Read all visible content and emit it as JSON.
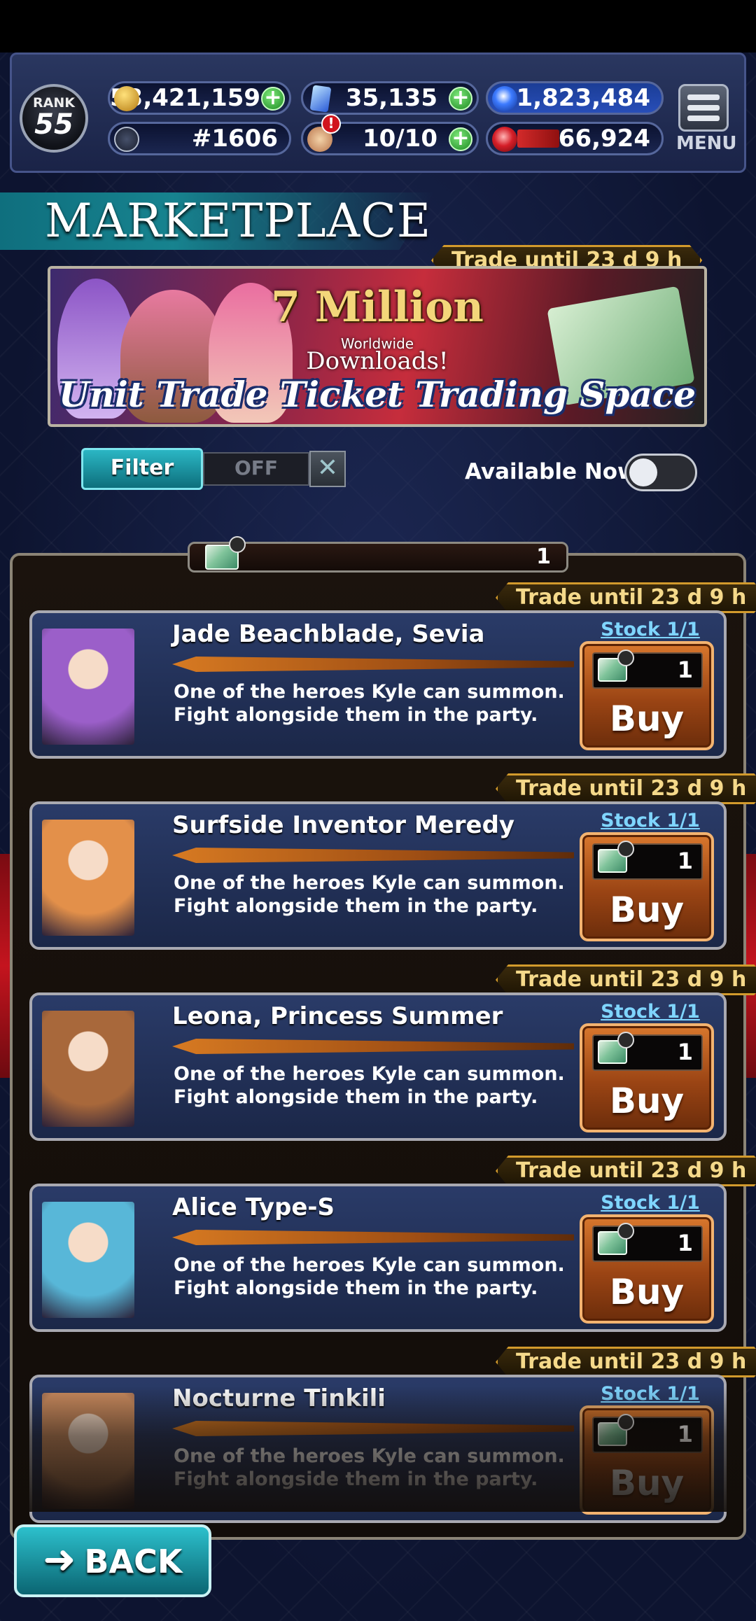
{
  "status_bar": {
    "rank_label": "RANK",
    "rank_value": "55",
    "gold": "53,421,159",
    "crystals": "35,135",
    "orbs": "1,823,484",
    "player_id": "#1606",
    "energy": "10/10",
    "energy_alert": "!",
    "power": "66,924",
    "menu_label": "MENU"
  },
  "header": {
    "title": "MARKETPLACE",
    "trade_period": "Trade until 23 d 9 h"
  },
  "banner": {
    "headline": "7 Million",
    "sub1": "Worldwide",
    "sub2": "Downloads!",
    "caption": "Unit Trade Ticket Trading Space"
  },
  "filter": {
    "label": "Filter",
    "state": "OFF",
    "clear_icon": "close-icon",
    "available_label": "Available Now",
    "available_on": false
  },
  "ticket_count": "1",
  "items": [
    {
      "name": "Jade Beachblade, Sevia",
      "trade_until": "Trade until 23 d 9 h",
      "line1": "One of the heroes Kyle can summon.",
      "line2": "Fight alongside them in the party.",
      "stock": "Stock 1/1",
      "price": "1",
      "buy": "Buy",
      "portrait_color": "#9b5fc9"
    },
    {
      "name": "Surfside Inventor Meredy",
      "trade_until": "Trade until 23 d 9 h",
      "line1": "One of the heroes Kyle can summon.",
      "line2": "Fight alongside them in the party.",
      "stock": "Stock 1/1",
      "price": "1",
      "buy": "Buy",
      "portrait_color": "#e3904a"
    },
    {
      "name": "Leona, Princess Summer",
      "trade_until": "Trade until 23 d 9 h",
      "line1": "One of the heroes Kyle can summon.",
      "line2": "Fight alongside them in the party.",
      "stock": "Stock 1/1",
      "price": "1",
      "buy": "Buy",
      "portrait_color": "#a8683b"
    },
    {
      "name": "Alice Type-S",
      "trade_until": "Trade until 23 d 9 h",
      "line1": "One of the heroes Kyle can summon.",
      "line2": "Fight alongside them in the party.",
      "stock": "Stock 1/1",
      "price": "1",
      "buy": "Buy",
      "portrait_color": "#58b7d8"
    },
    {
      "name": "Nocturne Tinkili",
      "trade_until": "Trade until 23 d 9 h",
      "line1": "One of the heroes Kyle can summon.",
      "line2": "Fight alongside them in the party.",
      "stock": "Stock 1/1",
      "price": "1",
      "buy": "Buy",
      "portrait_color": "#c98a5e"
    }
  ],
  "back_label": "BACK"
}
